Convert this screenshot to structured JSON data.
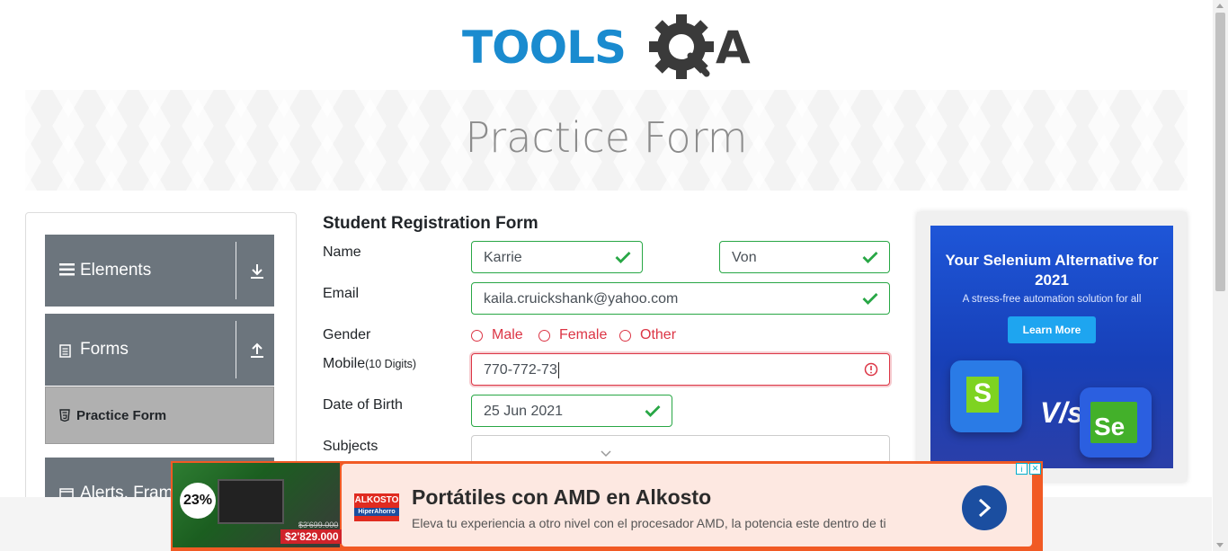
{
  "logo": {
    "text_left": "TOOLS",
    "text_right": "A",
    "icon": "gear-magnifier-icon"
  },
  "banner": {
    "title": "Practice Form"
  },
  "sidebar": {
    "groups": [
      {
        "label": "Elements",
        "icon": "hamburger-icon",
        "arrow": "download-arrow-icon"
      },
      {
        "label": "Forms",
        "icon": "document-icon",
        "arrow": "upload-arrow-icon"
      },
      {
        "label": "Alerts, Fram",
        "icon": "window-icon"
      }
    ],
    "active_item": {
      "label": "Practice Form",
      "icon": "html5-icon"
    }
  },
  "form": {
    "title": "Student Registration Form",
    "labels": {
      "name": "Name",
      "email": "Email",
      "gender": "Gender",
      "mobile": "Mobile",
      "mobile_hint": "(10 Digits)",
      "dob": "Date of Birth",
      "subjects": "Subjects"
    },
    "first_name": "Karrie",
    "last_name": "Von",
    "email": "kaila.cruickshank@yahoo.com",
    "gender_options": [
      "Male",
      "Female",
      "Other"
    ],
    "mobile": "770-772-73",
    "dob": "25 Jun 2021",
    "subjects": ""
  },
  "right_ad": {
    "title": "Your Selenium Alternative for 2021",
    "subtitle": "A stress-free automation solution for all",
    "button": "Learn More",
    "vs": "V/s",
    "left_logo": "S",
    "right_logo": "Se"
  },
  "bottom_ad": {
    "discount": "23%",
    "old_price": "$3'699.000",
    "new_price": "$2'829.000",
    "brand": "ALKOSTO",
    "brand_sub": "HiperAhorro",
    "title": "Portátiles con AMD en Alkosto",
    "subtitle": "Eleva tu experiencia a otro nivel con el procesador AMD, la potencia este dentro de ti"
  },
  "colors": {
    "valid": "#28a745",
    "invalid": "#dc3545",
    "sidebar_group": "#6c757d",
    "sidebar_active": "#b0b0b0",
    "logo_blue": "#1a8bcf",
    "ad_orange": "#f15a24"
  }
}
